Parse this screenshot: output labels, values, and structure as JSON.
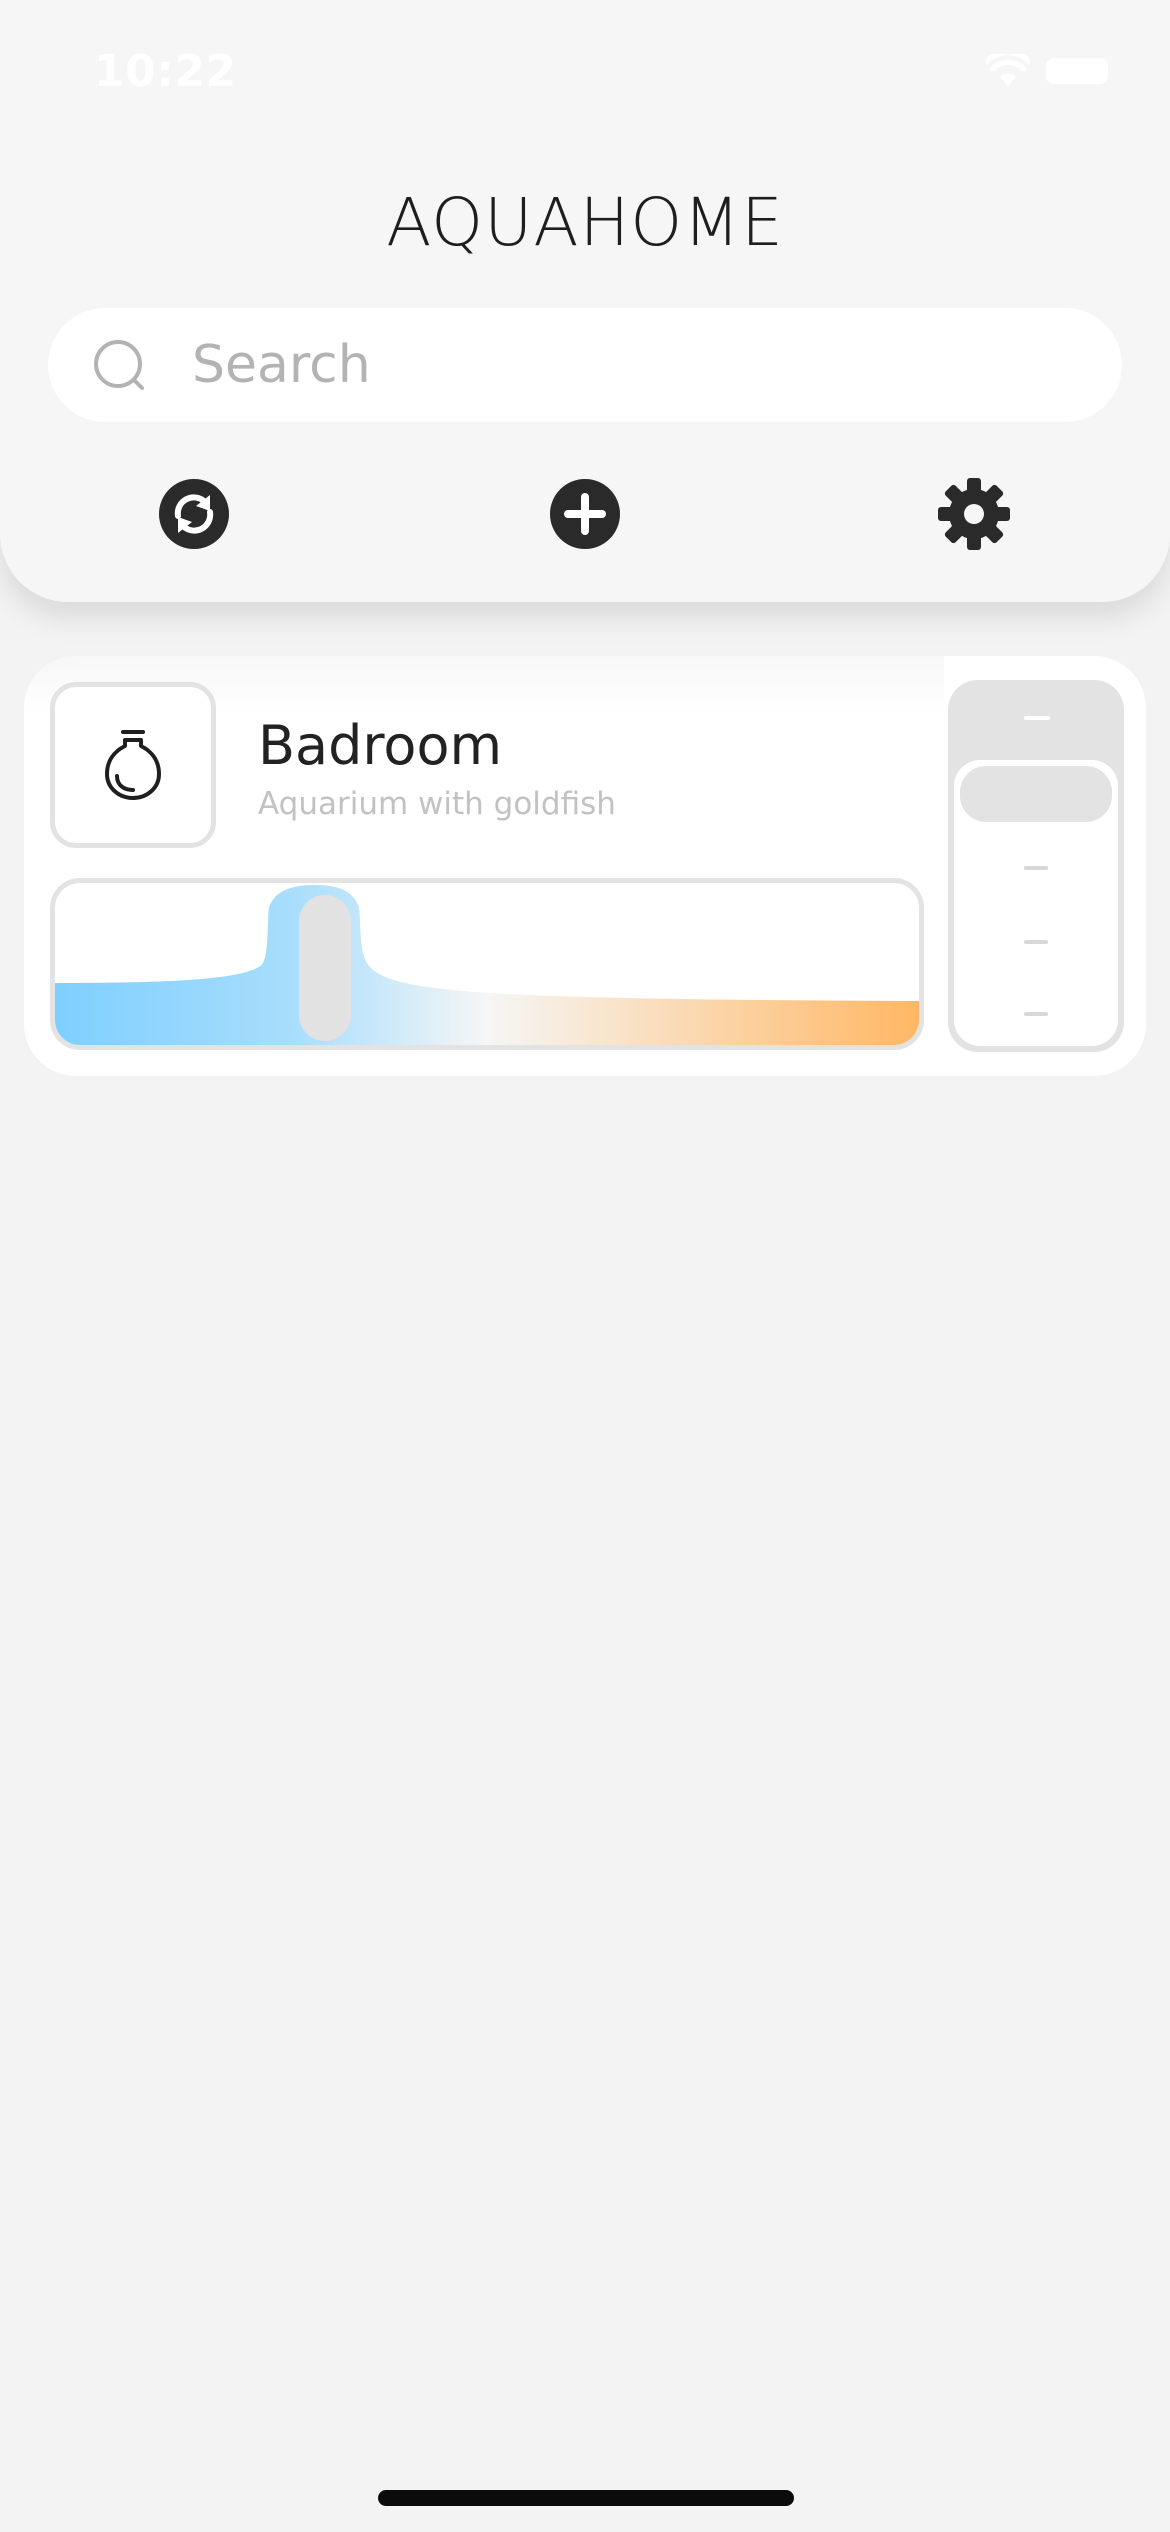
{
  "status_bar": {
    "time": "10:22"
  },
  "header": {
    "app_title": "AQUAHOME",
    "search": {
      "placeholder": "Search",
      "value": ""
    },
    "toolbar": {
      "refresh_icon": "refresh-icon",
      "add_icon": "add-icon",
      "settings_icon": "gear-icon"
    }
  },
  "rooms": [
    {
      "name": "Badroom",
      "subtitle": "Aquarium with goldfish",
      "icon": "lightbulb-icon",
      "color_temperature_position": 0.28,
      "level_step": 1,
      "level_steps": 5
    }
  ],
  "colors": {
    "cool": "#7ecfff",
    "neutral": "#f6f6f6",
    "warm": "#ffb764",
    "icon_dark": "#2a2a2a"
  }
}
